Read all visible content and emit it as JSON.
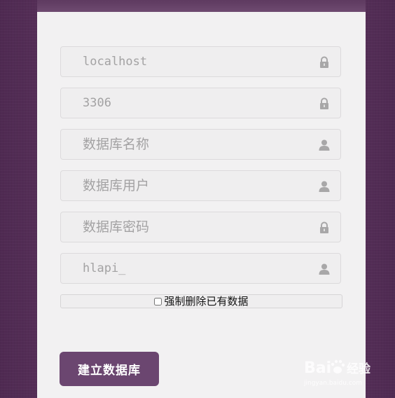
{
  "form": {
    "fields": [
      {
        "placeholder": "localhost",
        "icon": "lock-icon"
      },
      {
        "placeholder": "3306",
        "icon": "lock-icon"
      },
      {
        "placeholder": "数据库名称",
        "icon": "user-icon"
      },
      {
        "placeholder": "数据库用户",
        "icon": "user-icon"
      },
      {
        "placeholder": "数据库密码",
        "icon": "lock-icon"
      },
      {
        "placeholder": "hlapi_",
        "icon": "user-icon"
      }
    ],
    "force_delete_label": "强制删除已有数据",
    "force_delete_checked": false,
    "submit_label": "建立数据库"
  },
  "watermark": {
    "brand_text": "Bai",
    "brand_text_2": "经验",
    "url_text": "jingyan.baidu.com"
  },
  "colors": {
    "background": "#58315a",
    "panel": "#f2f1f2",
    "header": "#6e4a70",
    "button": "#6b4670",
    "icon": "#a8a7a8"
  }
}
